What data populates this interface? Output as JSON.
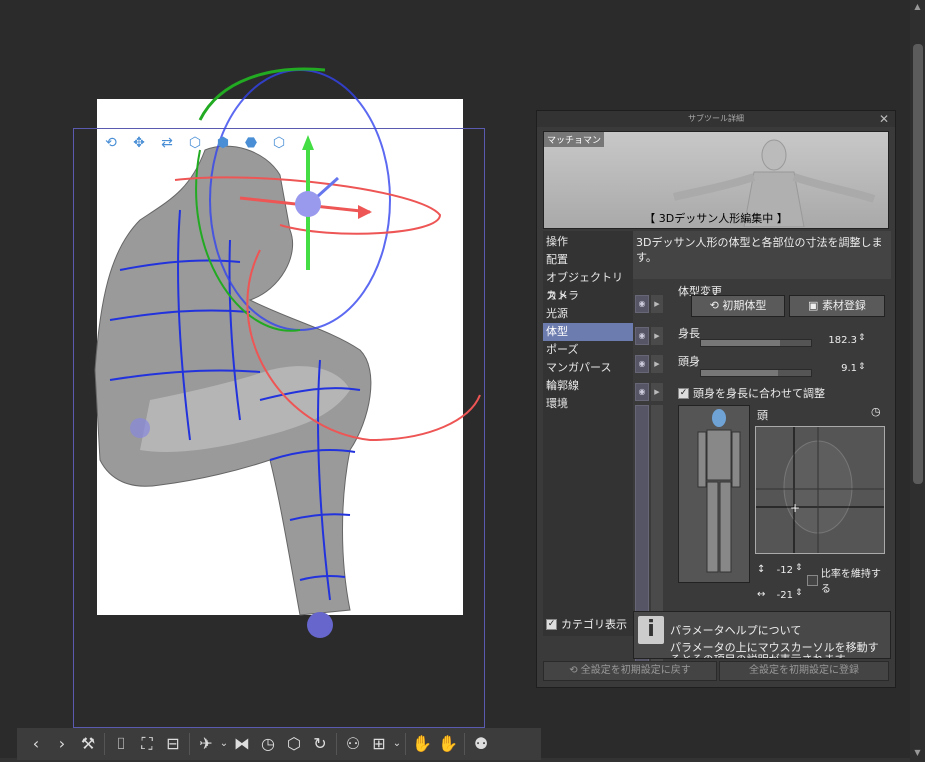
{
  "panel": {
    "title": "サブツール詳細",
    "close": "✕",
    "preview_name": "マッチョマン",
    "preview_caption": "【 3Dデッサン人形編集中 】",
    "description": "3Dデッサン人形の体型と各部位の寸法を調整します。",
    "categories": [
      "操作",
      "配置",
      "オブジェクトリスト",
      "カメラ",
      "光源",
      "体型",
      "ポーズ",
      "マンガパース",
      "輪郭線",
      "環境"
    ],
    "selected_category": "体型",
    "category_display_label": "カテゴリ表示",
    "body_change_label": "体型変更",
    "initial_body_button": "初期体型",
    "register_material_button": "素材登録",
    "height_label": "身長",
    "height_value": "182.3",
    "height_fraction": 0.72,
    "head_label": "頭身",
    "head_value": "9.1",
    "head_fraction": 0.7,
    "head_to_height_label": "頭身を身長に合わせて調整",
    "part_label": "頭",
    "vertical_value": "-12",
    "keep_ratio_label": "比率を維持する",
    "horizontal_value": "-21",
    "help_title": "パラメータヘルプについて",
    "help_text": "パラメータの上にマウスカーソルを移動するとその項目の説明が表示されます",
    "reset_all_button": "全設定を初期設定に戻す",
    "register_initial_button": "全設定を初期設定に登録"
  },
  "toolbar": {
    "items": [
      "prev-icon",
      "next-icon",
      "wrench-icon",
      "camera-icon",
      "fit-icon",
      "ground-icon",
      "pose-icon",
      "flip-icon",
      "reset-icon",
      "save-icon",
      "rotate-icon",
      "figure-icon",
      "body-icon",
      "left-hand-icon",
      "right-hand-icon",
      "model-icon"
    ]
  },
  "colors": {
    "selected": "#6d7cae",
    "accent_blue": "#4a8fd6"
  }
}
